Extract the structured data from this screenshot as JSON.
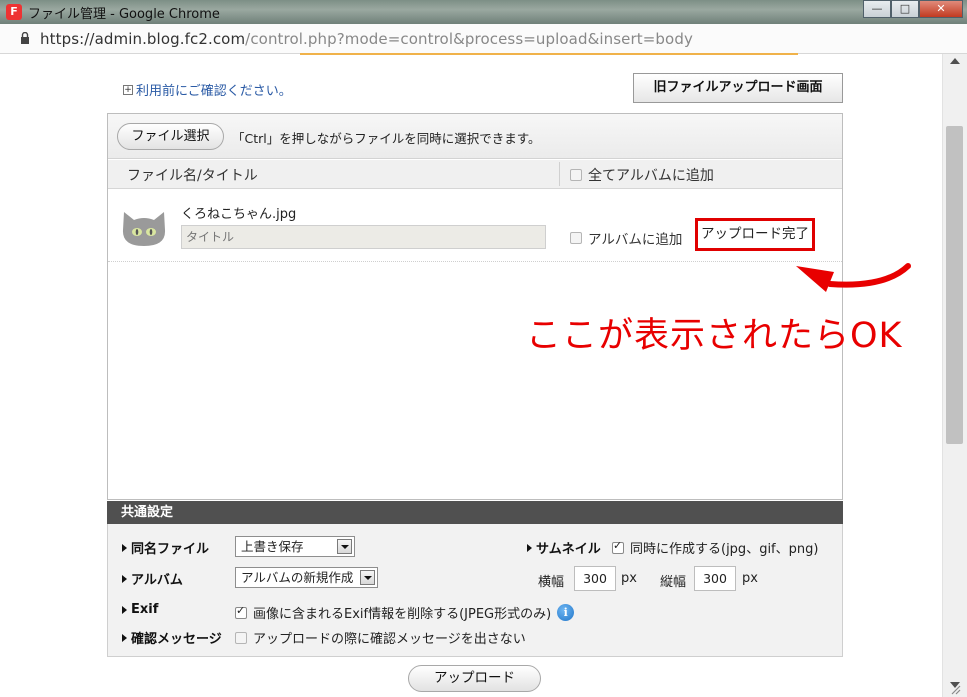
{
  "window": {
    "title": "ファイル管理 - Google Chrome",
    "app_icon": "fc2-icon",
    "buttons": {
      "minimize": "—",
      "maximize": "□",
      "close": "✕"
    }
  },
  "address": {
    "host": "https://admin.blog.fc2.com",
    "path": "/control.php?mode=control&process=upload&insert=body"
  },
  "page": {
    "notice_link": "利用前にご確認ください。",
    "old_upload_button": "旧ファイルアップロード画面",
    "choose_file_button": "ファイル選択",
    "toolbar_hint": "「Ctrl」を押しながらファイルを同時に選択できます。",
    "columns": {
      "name_title": "ファイル名/タイトル",
      "add_all_album": "全てアルバムに追加"
    },
    "file": {
      "name": "くろねこちゃん.jpg",
      "title_placeholder": "タイトル",
      "add_to_album": "アルバムに追加",
      "status": "アップロード完了"
    },
    "annotation": "ここが表示されたらOK"
  },
  "settings": {
    "header": "共通設定",
    "same_name_label": "同名ファイル",
    "same_name_value": "上書き保存",
    "album_label": "アルバム",
    "album_value": "アルバムの新規作成",
    "exif_label": "Exif",
    "exif_option": "画像に含まれるExif情報を削除する(JPEG形式のみ)",
    "exif_checked": true,
    "confirm_label": "確認メッセージ",
    "confirm_option": "アップロードの際に確認メッセージを出さない",
    "confirm_checked": false,
    "thumbnail_label": "サムネイル",
    "thumbnail_option": "同時に作成する(jpg、gif、png)",
    "thumbnail_checked": true,
    "width_label": "横幅",
    "width_value": "300",
    "height_label": "縦幅",
    "height_value": "300",
    "unit": "px"
  },
  "upload_button": "アップロード",
  "colors": {
    "accent_red": "#e00000",
    "link_blue": "#2a5aa5",
    "settings_header": "#505050"
  }
}
